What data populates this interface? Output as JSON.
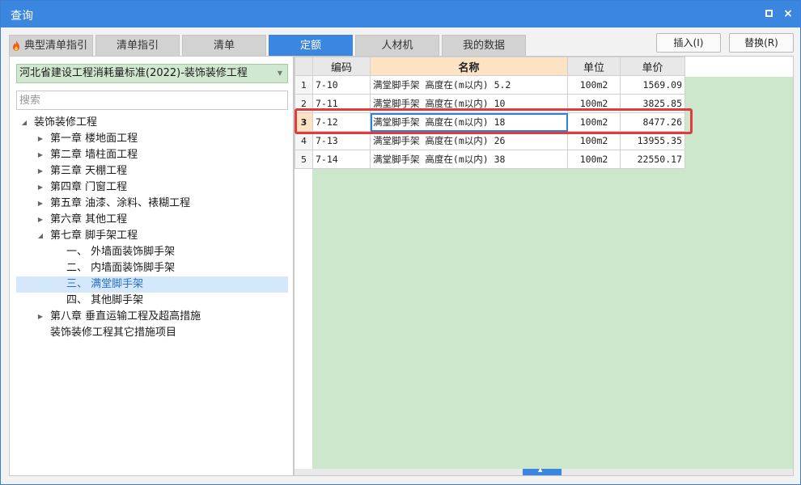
{
  "window": {
    "title": "查询"
  },
  "titlebar": {
    "maximize_symbol": "□",
    "close_symbol": "×"
  },
  "tabs": [
    {
      "label": "典型清单指引",
      "icon": "flame-icon"
    },
    {
      "label": "清单指引"
    },
    {
      "label": "清单"
    },
    {
      "label": "定额",
      "active": true
    },
    {
      "label": "人材机"
    },
    {
      "label": "我的数据"
    }
  ],
  "toolbar": {
    "insert_label": "插入(I)",
    "replace_label": "替换(R)"
  },
  "left": {
    "standard": "河北省建设工程消耗量标准(2022)-装饰装修工程",
    "search_placeholder": "搜索",
    "tree": [
      {
        "label": "装饰装修工程",
        "arrow": "◢",
        "level": 0
      },
      {
        "label": "第一章 楼地面工程",
        "arrow": "▶",
        "level": 1
      },
      {
        "label": "第二章 墙柱面工程",
        "arrow": "▶",
        "level": 1
      },
      {
        "label": "第三章 天棚工程",
        "arrow": "▶",
        "level": 1
      },
      {
        "label": "第四章 门窗工程",
        "arrow": "▶",
        "level": 1
      },
      {
        "label": "第五章 油漆、涂料、裱糊工程",
        "arrow": "▶",
        "level": 1
      },
      {
        "label": "第六章 其他工程",
        "arrow": "▶",
        "level": 1
      },
      {
        "label": "第七章 脚手架工程",
        "arrow": "◢",
        "level": 1
      },
      {
        "label": "一、 外墙面装饰脚手架",
        "arrow": "",
        "level": 2
      },
      {
        "label": "二、 内墙面装饰脚手架",
        "arrow": "",
        "level": 2
      },
      {
        "label": "三、 满堂脚手架",
        "arrow": "",
        "level": 2,
        "selected": true
      },
      {
        "label": "四、 其他脚手架",
        "arrow": "",
        "level": 2
      },
      {
        "label": "第八章 垂直运输工程及超高措施",
        "arrow": "▶",
        "level": 1
      },
      {
        "label": "装饰装修工程其它措施项目",
        "arrow": "",
        "level": 1
      }
    ]
  },
  "grid": {
    "headers": {
      "code": "编码",
      "name": "名称",
      "unit": "单位",
      "price": "单价"
    },
    "rows": [
      {
        "n": "1",
        "code": "7-10",
        "name": "满堂脚手架 高度在(m以内) 5.2",
        "unit": "100m2",
        "price": "1569.09"
      },
      {
        "n": "2",
        "code": "7-11",
        "name": "满堂脚手架 高度在(m以内) 10",
        "unit": "100m2",
        "price": "3825.85"
      },
      {
        "n": "3",
        "code": "7-12",
        "name": "满堂脚手架 高度在(m以内) 18",
        "unit": "100m2",
        "price": "8477.26",
        "current": true
      },
      {
        "n": "4",
        "code": "7-13",
        "name": "满堂脚手架 高度在(m以内) 26",
        "unit": "100m2",
        "price": "13955.35"
      },
      {
        "n": "5",
        "code": "7-14",
        "name": "满堂脚手架 高度在(m以内) 38",
        "unit": "100m2",
        "price": "22550.17"
      }
    ]
  },
  "scroll": {
    "thumb_symbol": "▲"
  },
  "colors": {
    "accent": "#3b86df",
    "highlight": "#e23b3b",
    "green_area": "#cde7cd"
  }
}
